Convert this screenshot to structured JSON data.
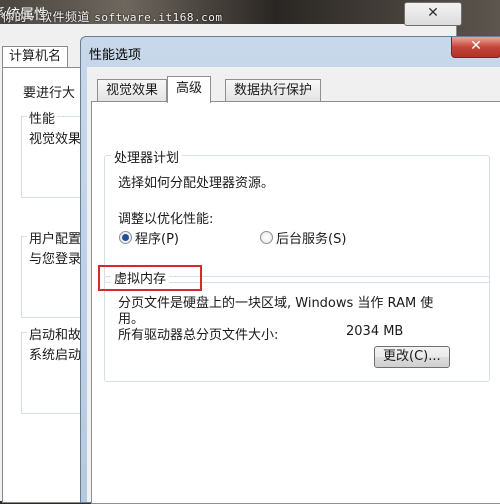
{
  "watermark": {
    "text": "你的 · 软件频道",
    "url": "software.it168.com"
  },
  "bg_window": {
    "title_fragment": "系统属性",
    "close_icon": "close-icon",
    "tab_label": "计算机名",
    "admin_text": "要进行大",
    "group_performance": "性能",
    "performance_text": "视觉效果",
    "group_user_profile": "用户配置",
    "user_profile_text": "与您登录",
    "group_startup": "启动和故",
    "startup_text": "系统启动"
  },
  "dialog": {
    "title": "性能选项",
    "close_icon": "close-icon",
    "tabs": [
      {
        "label": "视觉效果",
        "active": false
      },
      {
        "label": "高级",
        "active": true
      },
      {
        "label": "数据执行保护",
        "active": false
      }
    ],
    "processor_group": {
      "legend": "处理器计划",
      "description": "选择如何分配处理器资源。",
      "adjust_label": "调整以优化性能:",
      "options": [
        {
          "label": "程序(P)",
          "checked": true
        },
        {
          "label": "后台服务(S)",
          "checked": false
        }
      ]
    },
    "virtual_memory_group": {
      "legend": "虚拟内存",
      "description_line1": "分页文件是硬盘上的一块区域, Windows 当作 RAM 使",
      "description_line2": "用。",
      "total_label": "所有驱动器总分页文件大小:",
      "total_value": "2034 MB",
      "change_button": "更改(C)..."
    }
  },
  "colors": {
    "highlight": "#d32a2a",
    "radio_selected": "#1e4f9c",
    "close_button": "#c4453a"
  }
}
